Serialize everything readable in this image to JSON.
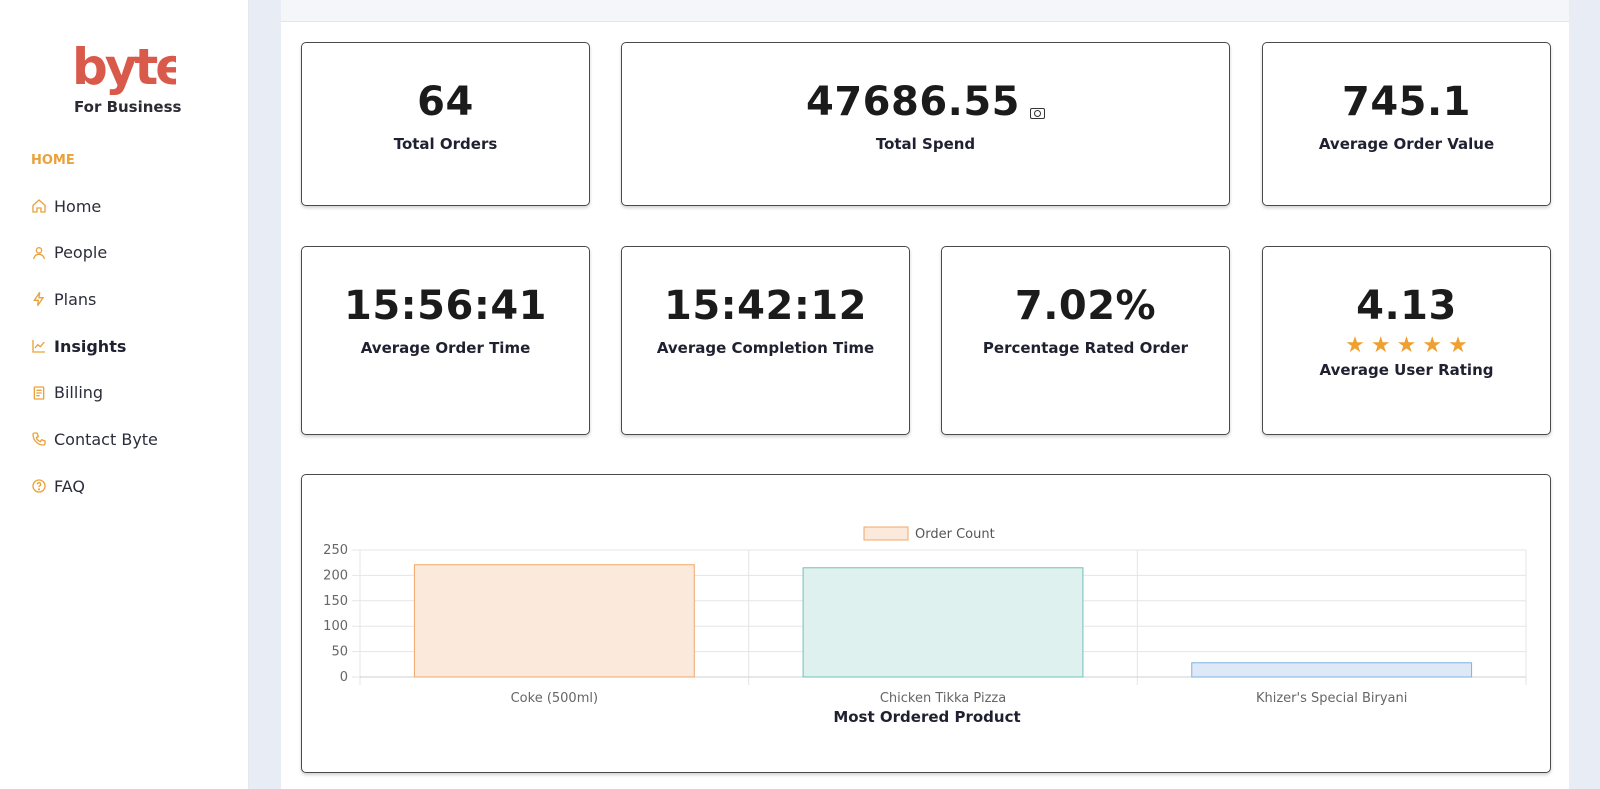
{
  "brand": {
    "logo_text": "byte",
    "subtitle": "For Business",
    "color": "#d9594a"
  },
  "sidebar": {
    "section_label": "HOME",
    "accent": "#e9a23b",
    "items": [
      {
        "label": "Home",
        "icon": "home-icon",
        "active": false
      },
      {
        "label": "People",
        "icon": "person-icon",
        "active": false
      },
      {
        "label": "Plans",
        "icon": "lightning-icon",
        "active": false
      },
      {
        "label": "Insights",
        "icon": "trend-chart-icon",
        "active": true
      },
      {
        "label": "Billing",
        "icon": "receipt-icon",
        "active": false
      },
      {
        "label": "Contact Byte",
        "icon": "phone-icon",
        "active": false
      },
      {
        "label": "FAQ",
        "icon": "question-circle-icon",
        "active": false
      }
    ]
  },
  "stats": {
    "total_orders": {
      "value": "64",
      "label": "Total Orders"
    },
    "total_spend": {
      "value": "47686.55",
      "label": "Total Spend",
      "icon": "money-bill-icon"
    },
    "average_order_value": {
      "value": "745.1",
      "label": "Average Order Value"
    },
    "average_order_time": {
      "value": "15:56:41",
      "label": "Average Order Time"
    },
    "average_completion_time": {
      "value": "15:42:12",
      "label": "Average Completion Time"
    },
    "percentage_rated_order": {
      "value": "7.02%",
      "label": "Percentage Rated Order"
    },
    "average_user_rating": {
      "value": "4.13",
      "label": "Average User Rating",
      "stars": 5,
      "star_color": "#f0a030"
    }
  },
  "chart_data": {
    "type": "bar",
    "categories": [
      "Coke (500ml)",
      "Chicken Tikka Pizza",
      "Khizer's Special Biryani"
    ],
    "series": [
      {
        "name": "Order Count",
        "values": [
          221,
          215,
          28
        ]
      }
    ],
    "bar_fills": [
      "#fbeadb",
      "#dff1ef",
      "#dde9f7"
    ],
    "bar_strokes": [
      "#f0a76a",
      "#6fc1bb",
      "#7fb2e2"
    ],
    "legend_fill": "#fbeadb",
    "legend_stroke": "#f0a76a",
    "legend_position": "top",
    "xlabel": "Most Ordered Product",
    "ylabel": "",
    "ylim": [
      0,
      250
    ],
    "yticks": [
      "0",
      "50",
      "100",
      "150",
      "200",
      "250"
    ],
    "grid": true
  }
}
